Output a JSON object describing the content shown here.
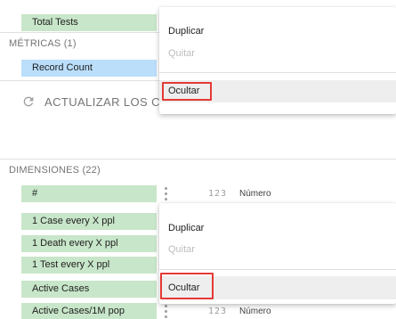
{
  "metrics_section": {
    "total_tests_label": "Total Tests",
    "header": "MÉTRICAS (1)",
    "record_count_label": "Record Count",
    "refresh_label": "ACTUALIZAR LOS CAMPOS"
  },
  "dimensions_section": {
    "header": "DIMENSIONES (22)",
    "fields": [
      {
        "label": "#"
      },
      {
        "label": "1 Case every X ppl"
      },
      {
        "label": "1 Death every X ppl"
      },
      {
        "label": "1 Test every X ppl"
      },
      {
        "label": "Active Cases"
      },
      {
        "label": "Active Cases/1M pop"
      }
    ],
    "type_icon": "123",
    "type_label": "Número"
  },
  "menus": [
    {
      "duplicate": "Duplicar",
      "remove": "Quitar",
      "hide": "Ocultar"
    },
    {
      "duplicate": "Duplicar",
      "remove": "Quitar",
      "hide": "Ocultar"
    }
  ],
  "colors": {
    "dimension_field": "#c8e6c9",
    "metric_field": "#bbdefb",
    "highlight_border": "#e53935"
  }
}
